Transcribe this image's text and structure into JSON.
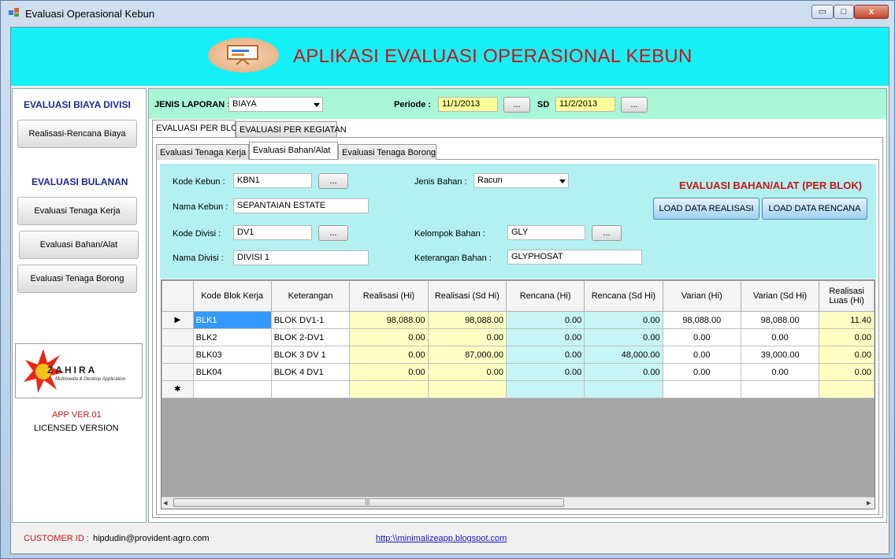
{
  "window": {
    "title": "Evaluasi Operasional Kebun",
    "min": "▭",
    "max": "□",
    "close": "x"
  },
  "banner": {
    "title": "APLIKASI EVALUASI OPERASIONAL KEBUN"
  },
  "sidebar": {
    "section1": "EVALUASI BIAYA DIVISI",
    "btn_realisasi": "Realisasi-Rencana Biaya",
    "section2": "EVALUASI BULANAN",
    "btn_tenaga_kerja": "Evaluasi Tenaga Kerja",
    "btn_bahan_alat": "Evaluasi Bahan/Alat",
    "btn_tenaga_borong": "Evaluasi Tenaga Borong",
    "logo_name": "ZAHIRA",
    "logo_tagline": "Multimedia & Desktop Application",
    "version": "APP VER.01",
    "license": "LICENSED VERSION"
  },
  "filter": {
    "jenis_label": "JENIS LAPORAN :",
    "jenis_value": "BIAYA",
    "periode_label": "Periode :",
    "periode_from": "11/1/2013",
    "sd_label": "SD",
    "periode_to": "11/2/2013",
    "browse": "..."
  },
  "tabs_main": [
    "EVALUASI PER BLOK",
    "EVALUASI PER KEGIATAN"
  ],
  "tabs_sub": [
    "Evaluasi Tenaga Kerja",
    "Evaluasi Bahan/Alat",
    "Evaluasi Tenaga Borong"
  ],
  "form": {
    "kode_kebun_label": "Kode Kebun :",
    "kode_kebun": "KBN1",
    "nama_kebun_label": "Nama Kebun :",
    "nama_kebun": "SEPANTAIAN ESTATE",
    "kode_divisi_label": "Kode Divisi :",
    "kode_divisi": "DV1",
    "nama_divisi_label": "Nama Divisi :",
    "nama_divisi": "DIVISI 1",
    "jenis_bahan_label": "Jenis Bahan :",
    "jenis_bahan": "Racun",
    "kelompok_label": "Kelompok Bahan :",
    "kelompok": "GLY",
    "keterangan_label": "Keterangan Bahan :",
    "keterangan": "GLYPHOSAT",
    "heading": "EVALUASI BAHAN/ALAT (PER BLOK)",
    "load_realisasi": "LOAD DATA REALISASI",
    "load_rencana": "LOAD DATA RENCANA",
    "browse": "..."
  },
  "grid": {
    "columns": [
      "Kode Blok Kerja",
      "Keterangan",
      "Realisasi (Hi)",
      "Realisasi (Sd Hi)",
      "Rencana (Hi)",
      "Rencana (Sd Hi)",
      "Varian (Hi)",
      "Varian (Sd Hi)",
      "Realisasi Luas (Hi)"
    ],
    "rows": [
      [
        "BLK1",
        "BLOK DV1-1",
        "98,088.00",
        "98,088.00",
        "0.00",
        "0.00",
        "98,088.00",
        "98,088.00",
        "11.40"
      ],
      [
        "BLK2",
        "BLOK 2-DV1",
        "0.00",
        "0.00",
        "0.00",
        "0.00",
        "0.00",
        "0.00",
        "0.00"
      ],
      [
        "BLK03",
        "BLOK 3 DV 1",
        "0.00",
        "87,000.00",
        "0.00",
        "48,000.00",
        "0.00",
        "39,000.00",
        "0.00"
      ],
      [
        "BLK04",
        "BLOK 4 DV1",
        "0.00",
        "0.00",
        "0.00",
        "0.00",
        "0.00",
        "0.00",
        "0.00"
      ]
    ],
    "current_marker": "▶",
    "new_marker": "✱",
    "scroll_left": "◂",
    "scroll_right": "▸",
    "scroll_grip": "|||"
  },
  "status": {
    "customer_label": "CUSTOMER ID :",
    "customer_value": "hipdudin@provident-agro.com",
    "link": "http:\\\\minimalizeapp.blogspot.com"
  }
}
